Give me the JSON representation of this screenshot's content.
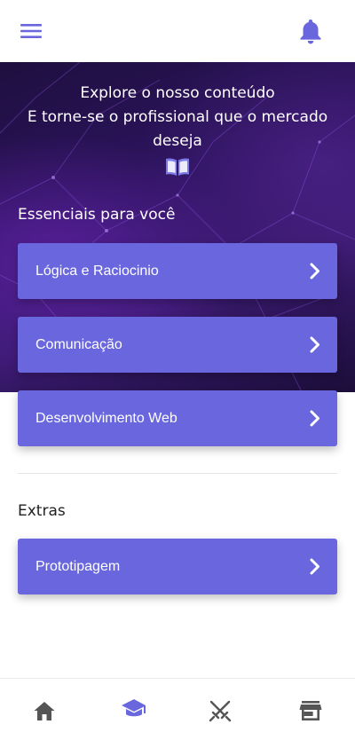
{
  "theme": {
    "accent": "#6a67de",
    "nav_active": "#6a67de",
    "nav_inactive": "#555555"
  },
  "header": {
    "menu_icon": "hamburger-menu-icon",
    "notification_icon": "bell-icon"
  },
  "hero": {
    "line1": "Explore o nosso conteúdo",
    "line2": "E torne-se o profissional que o mercado",
    "line3": "deseja",
    "icon": "open-book-icon"
  },
  "essenciais": {
    "title": "Essenciais para você",
    "items": [
      {
        "label": "Lógica e Raciocinio"
      },
      {
        "label": "Comunicação"
      },
      {
        "label": "Desenvolvimento Web"
      }
    ]
  },
  "extras": {
    "title": "Extras",
    "items": [
      {
        "label": "Prototipagem"
      }
    ]
  },
  "bottom_nav": {
    "items": [
      {
        "icon": "home-icon",
        "active": false
      },
      {
        "icon": "graduation-cap-icon",
        "active": true
      },
      {
        "icon": "crossed-swords-icon",
        "active": false
      },
      {
        "icon": "store-icon",
        "active": false
      }
    ]
  }
}
